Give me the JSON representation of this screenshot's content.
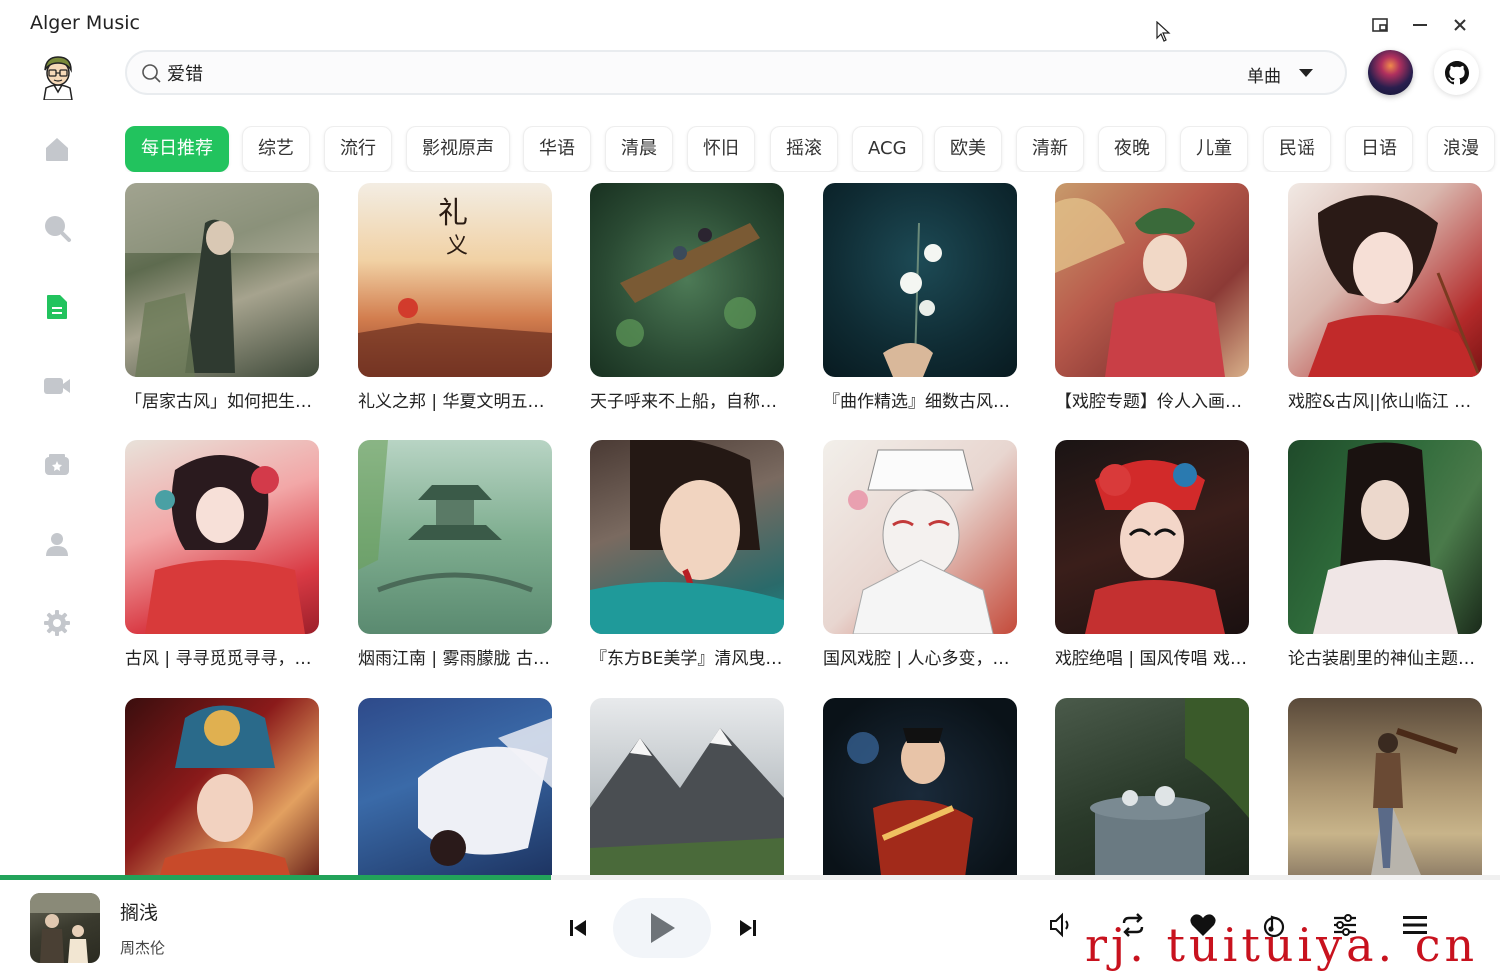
{
  "app": {
    "title": "Alger Music"
  },
  "search": {
    "value": "爱错",
    "type_label": "单曲"
  },
  "tabs": [
    "每日推荐",
    "综艺",
    "流行",
    "影视原声",
    "华语",
    "清晨",
    "怀旧",
    "摇滚",
    "ACG",
    "欧美",
    "清新",
    "夜晚",
    "儿童",
    "民谣",
    "日语",
    "浪漫"
  ],
  "active_tab": "每日推荐",
  "playlists": [
    {
      "title": "「居家古风」如何把生…"
    },
    {
      "title": "礼义之邦 | 华夏文明五…"
    },
    {
      "title": "天子呼来不上船，自称…"
    },
    {
      "title": "『曲作精选』细数古风…"
    },
    {
      "title": "【戏腔专题】伶人入画…"
    },
    {
      "title": "戏腔&古风||依山临江 …"
    },
    {
      "title": "古风 | 寻寻觅觅寻寻，…"
    },
    {
      "title": "烟雨江南 | 雾雨朦胧 古…"
    },
    {
      "title": "『东方BE美学』清风曳…"
    },
    {
      "title": "国风戏腔 | 人心多变，…"
    },
    {
      "title": "戏腔绝唱 | 国风传唱 戏…"
    },
    {
      "title": "论古装剧里的神仙主题…"
    },
    {
      "title": ""
    },
    {
      "title": ""
    },
    {
      "title": ""
    },
    {
      "title": ""
    },
    {
      "title": ""
    },
    {
      "title": ""
    }
  ],
  "player": {
    "song_title": "搁浅",
    "artist": "周杰伦",
    "progress": 0.367
  },
  "watermark": "rj. tuituiya. cn",
  "colors": {
    "accent": "#22c35e",
    "progress": "#22a35a"
  }
}
